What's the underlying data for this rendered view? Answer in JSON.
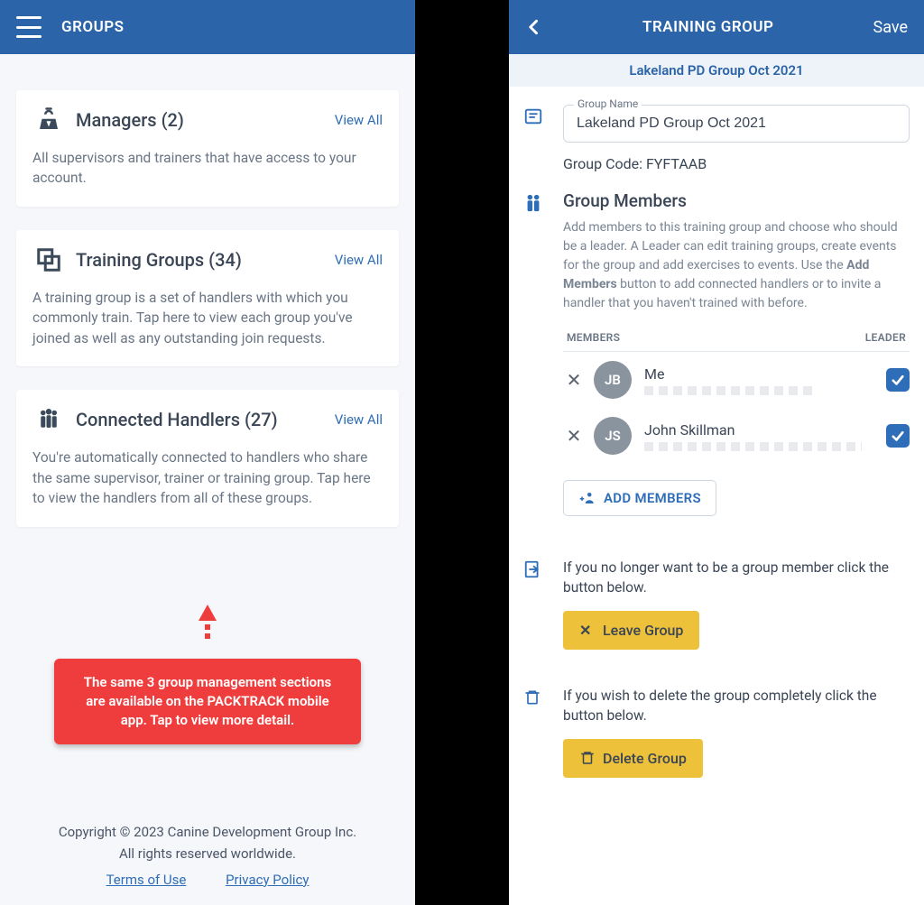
{
  "left": {
    "header_title": "GROUPS",
    "cards": [
      {
        "title": "Managers (2)",
        "view_all": "View All",
        "desc": "All supervisors and trainers that have access to your account."
      },
      {
        "title": "Training Groups (34)",
        "view_all": "View All",
        "desc": "A training group is a set of handlers with which you commonly train. Tap here to view each group you've joined as well as any outstanding join requests."
      },
      {
        "title": "Connected Handlers (27)",
        "view_all": "View All",
        "desc": "You're automatically connected to handlers who share the same supervisor, trainer or training group. Tap here to view the handlers from all of these groups."
      }
    ],
    "callout": "The same 3 group management sections are available on the PACKTRACK mobile app. Tap to view more detail.",
    "footer_line1": "Copyright © 2023 Canine Development Group Inc.",
    "footer_line2": "All rights reserved worldwide.",
    "terms": "Terms of Use",
    "privacy": "Privacy Policy"
  },
  "right": {
    "header_title": "TRAINING GROUP",
    "save": "Save",
    "subheader": "Lakeland PD Group Oct 2021",
    "group_name_label": "Group Name",
    "group_name_value": "Lakeland PD Group Oct 2021",
    "group_code_label": "Group Code: FYFTAAB",
    "members_title": "Group Members",
    "members_desc_1": "Add members to this training group and choose who should be a leader. A Leader can edit training groups, create events for the group and add exercises to events. Use the ",
    "members_desc_bold": "Add Members",
    "members_desc_2": " button to add connected handlers or to invite a handler that you haven't trained with before.",
    "col_members": "MEMBERS",
    "col_leader": "LEADER",
    "members": [
      {
        "initials": "JB",
        "name": "Me"
      },
      {
        "initials": "JS",
        "name": "John Skillman"
      }
    ],
    "add_members": "ADD MEMBERS",
    "leave_desc": "If you no longer want to be a group member click the button below.",
    "leave_btn": "Leave Group",
    "delete_desc": "If you wish to delete the group completely click the button below.",
    "delete_btn": "Delete Group"
  }
}
